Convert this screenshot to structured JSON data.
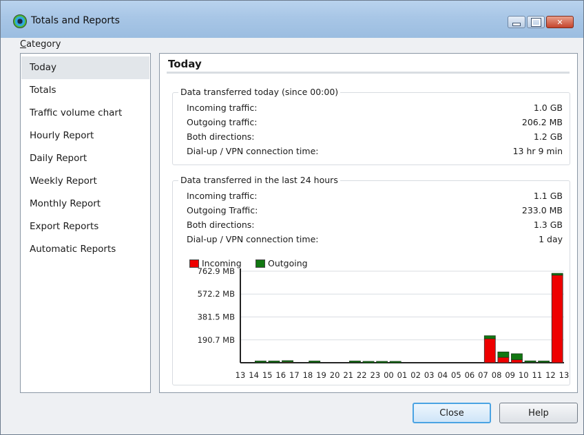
{
  "window": {
    "title": "Totals and Reports"
  },
  "sidebar": {
    "label_prefix": "C",
    "label_rest": "ategory",
    "items": [
      {
        "label": "Today",
        "active": true
      },
      {
        "label": "Totals"
      },
      {
        "label": "Traffic volume chart"
      },
      {
        "label": "Hourly Report"
      },
      {
        "label": "Daily Report"
      },
      {
        "label": "Weekly Report"
      },
      {
        "label": "Monthly Report"
      },
      {
        "label": "Export Reports"
      },
      {
        "label": "Automatic Reports"
      }
    ]
  },
  "main": {
    "title": "Today",
    "today_group": {
      "legend": "Data transferred today (since 00:00)",
      "rows": [
        {
          "label": "Incoming traffic:",
          "value": "1.0 GB"
        },
        {
          "label": "Outgoing traffic:",
          "value": "206.2 MB"
        },
        {
          "label": "Both directions:",
          "value": "1.2 GB"
        },
        {
          "label": "Dial-up / VPN connection time:",
          "value": "13 hr 9 min"
        }
      ]
    },
    "last24_group": {
      "legend": "Data transferred in the last 24 hours",
      "rows": [
        {
          "label": "Incoming traffic:",
          "value": "1.1 GB"
        },
        {
          "label": "Outgoing Traffic:",
          "value": "233.0 MB"
        },
        {
          "label": "Both directions:",
          "value": "1.3 GB"
        },
        {
          "label": "Dial-up / VPN connection time:",
          "value": "1 day"
        }
      ]
    }
  },
  "chart_data": {
    "type": "bar",
    "legend": [
      {
        "name": "Incoming",
        "color": "#ee0000"
      },
      {
        "name": "Outgoing",
        "color": "#117711"
      }
    ],
    "y_ticks": [
      "762.9 MB",
      "572.2 MB",
      "381.5 MB",
      "190.7 MB"
    ],
    "y_tick_values": [
      762.9,
      572.2,
      381.5,
      190.7
    ],
    "ylim": [
      0,
      762.9
    ],
    "categories": [
      "13",
      "14",
      "15",
      "16",
      "17",
      "18",
      "19",
      "20",
      "21",
      "22",
      "23",
      "00",
      "01",
      "02",
      "03",
      "04",
      "05",
      "06",
      "07",
      "08",
      "09",
      "10",
      "11",
      "12",
      "13"
    ],
    "series": [
      {
        "name": "Incoming",
        "values": [
          0,
          3,
          3,
          6,
          0,
          3,
          0,
          0,
          3,
          0,
          0,
          0,
          0,
          0,
          0,
          0,
          0,
          0,
          200,
          45,
          25,
          4,
          3,
          730,
          0
        ]
      },
      {
        "name": "Outgoing",
        "values": [
          0,
          5,
          5,
          10,
          0,
          6,
          0,
          0,
          6,
          3,
          2,
          3,
          0,
          0,
          0,
          0,
          0,
          0,
          25,
          45,
          50,
          10,
          3,
          15,
          0
        ]
      }
    ]
  },
  "buttons": {
    "close": "Close",
    "help": "Help"
  }
}
